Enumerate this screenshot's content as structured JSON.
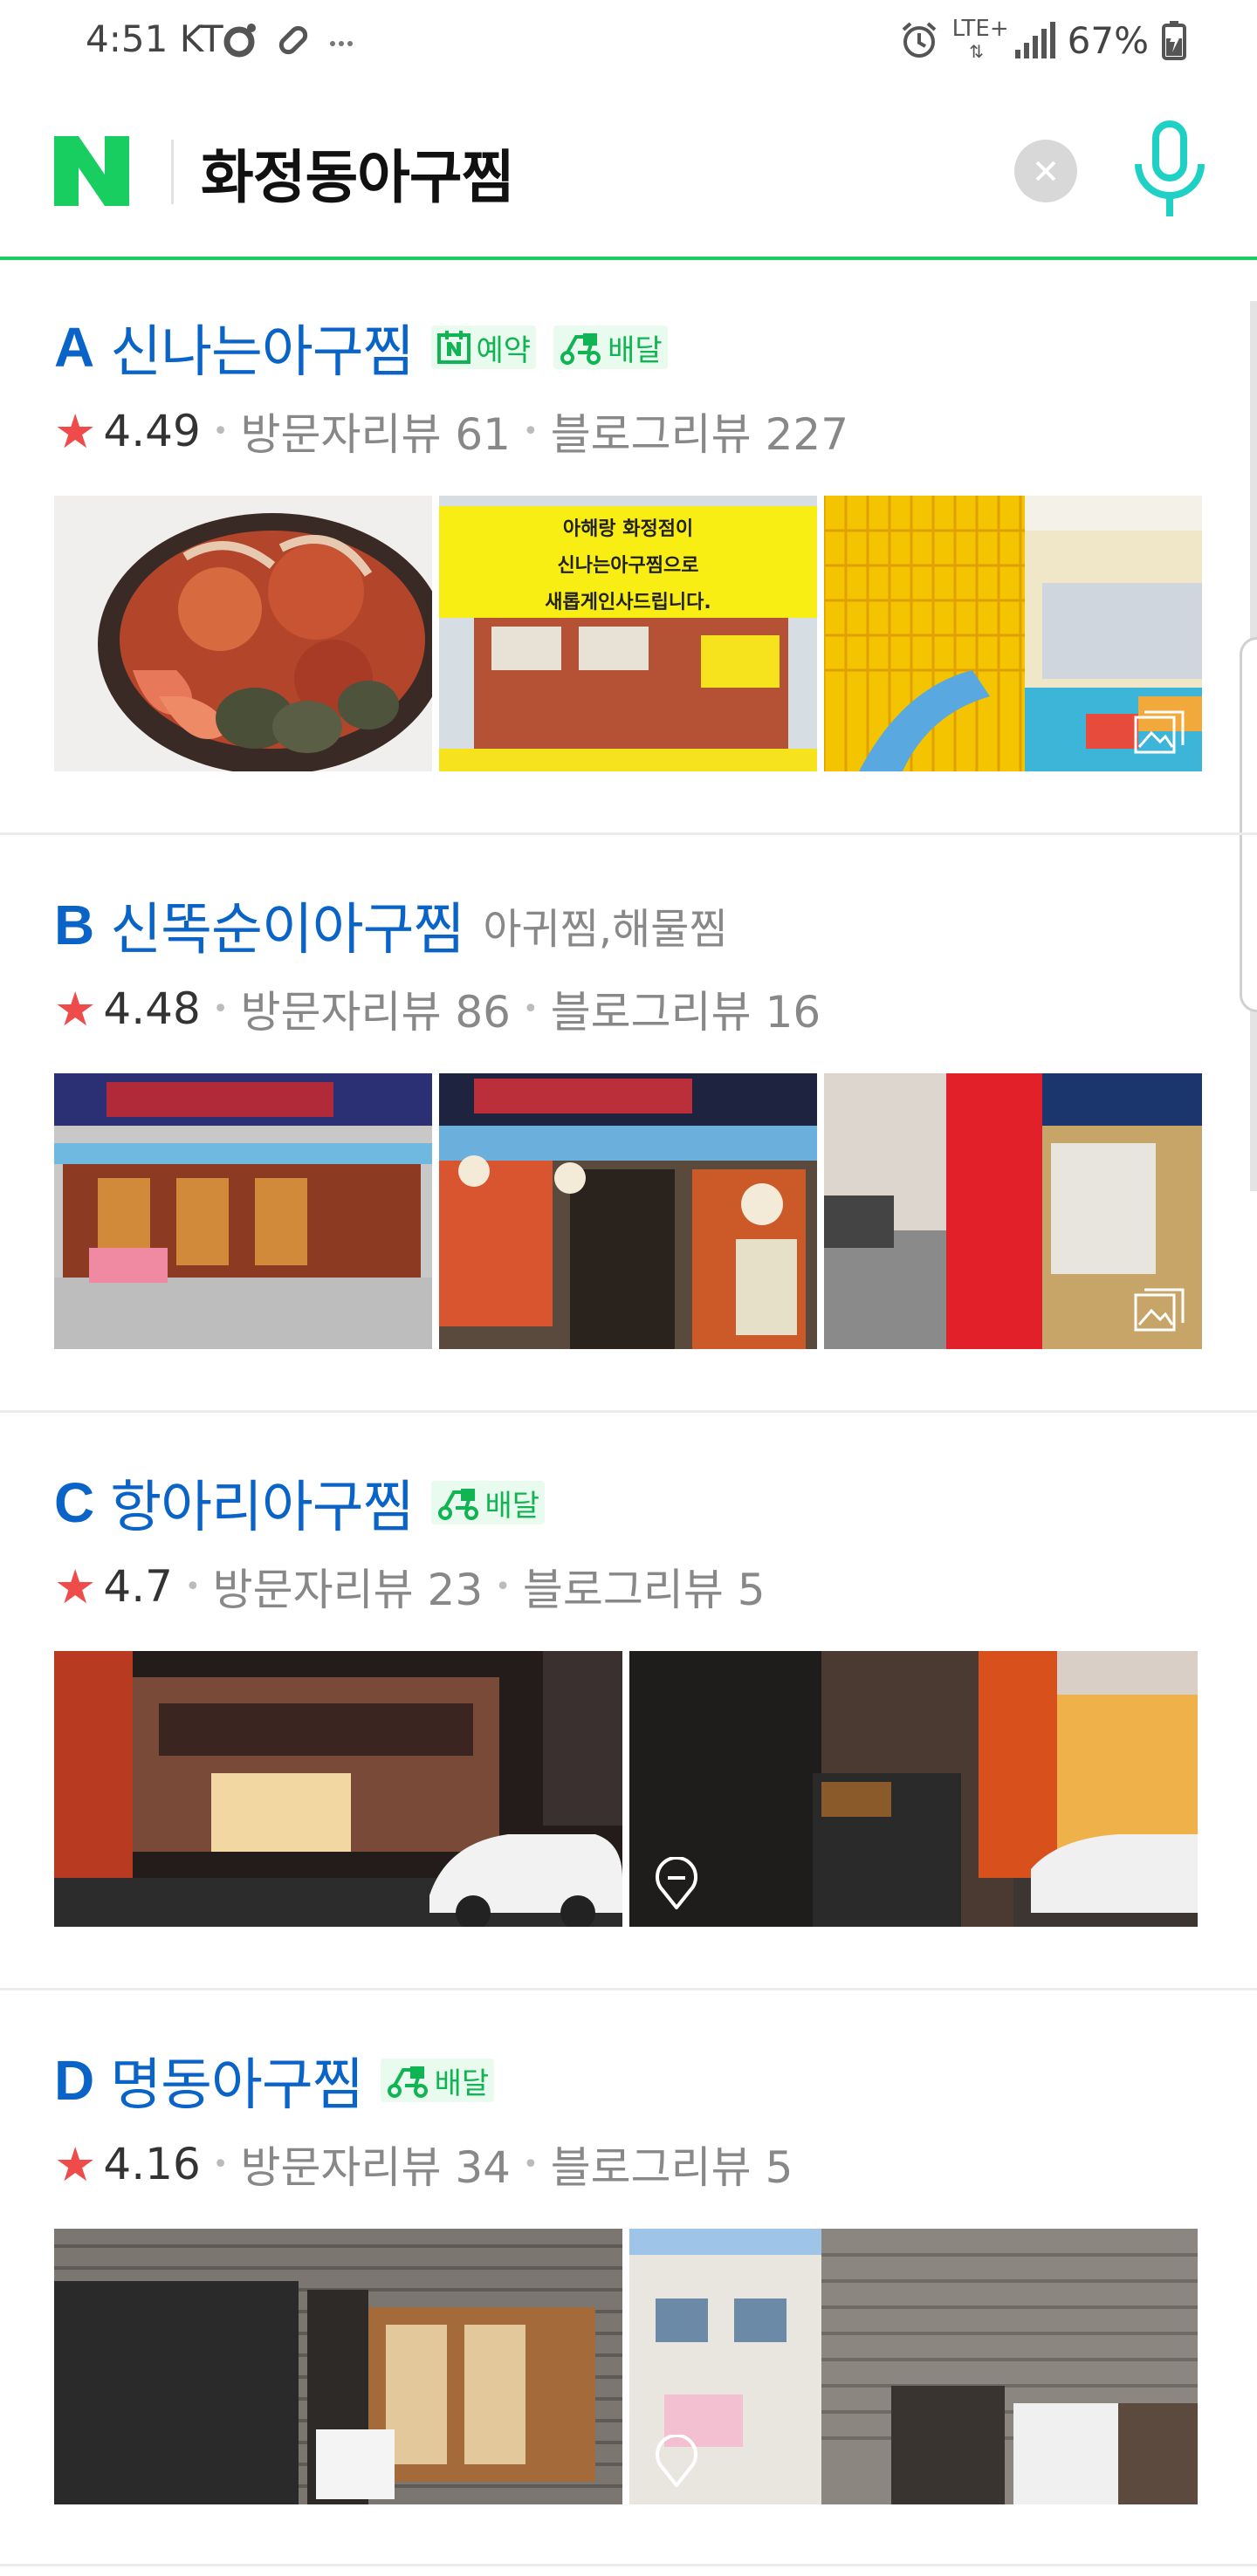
{
  "status_bar": {
    "time": "4:51",
    "carrier": "KT",
    "network": "LTE+",
    "battery": "67%"
  },
  "search": {
    "query": "화정동아구찜"
  },
  "colors": {
    "naver_green": "#19ce60",
    "title_blue": "#0a64c8",
    "star_red": "#f04b4b",
    "badge_green": "#10b452"
  },
  "results": [
    {
      "letter": "A",
      "name": "신나는아구찜",
      "category": "",
      "badges": [
        "예약",
        "배달"
      ],
      "score": "4.49",
      "visitor_review": "방문자리뷰 61",
      "blog_review": "블로그리뷰 227",
      "photo_banner_lines": [
        "아해랑 화정점이",
        "신나는아구찜으로",
        "새롭게인사드립니다."
      ]
    },
    {
      "letter": "B",
      "name": "신똑순이아구찜",
      "category": "아귀찜,해물찜",
      "badges": [],
      "score": "4.48",
      "visitor_review": "방문자리뷰 86",
      "blog_review": "블로그리뷰 16"
    },
    {
      "letter": "C",
      "name": "항아리아구찜",
      "category": "",
      "badges": [
        "배달"
      ],
      "score": "4.7",
      "visitor_review": "방문자리뷰 23",
      "blog_review": "블로그리뷰 5"
    },
    {
      "letter": "D",
      "name": "명동아구찜",
      "category": "",
      "badges": [
        "배달"
      ],
      "score": "4.16",
      "visitor_review": "방문자리뷰 34",
      "blog_review": "블로그리뷰 5"
    }
  ]
}
